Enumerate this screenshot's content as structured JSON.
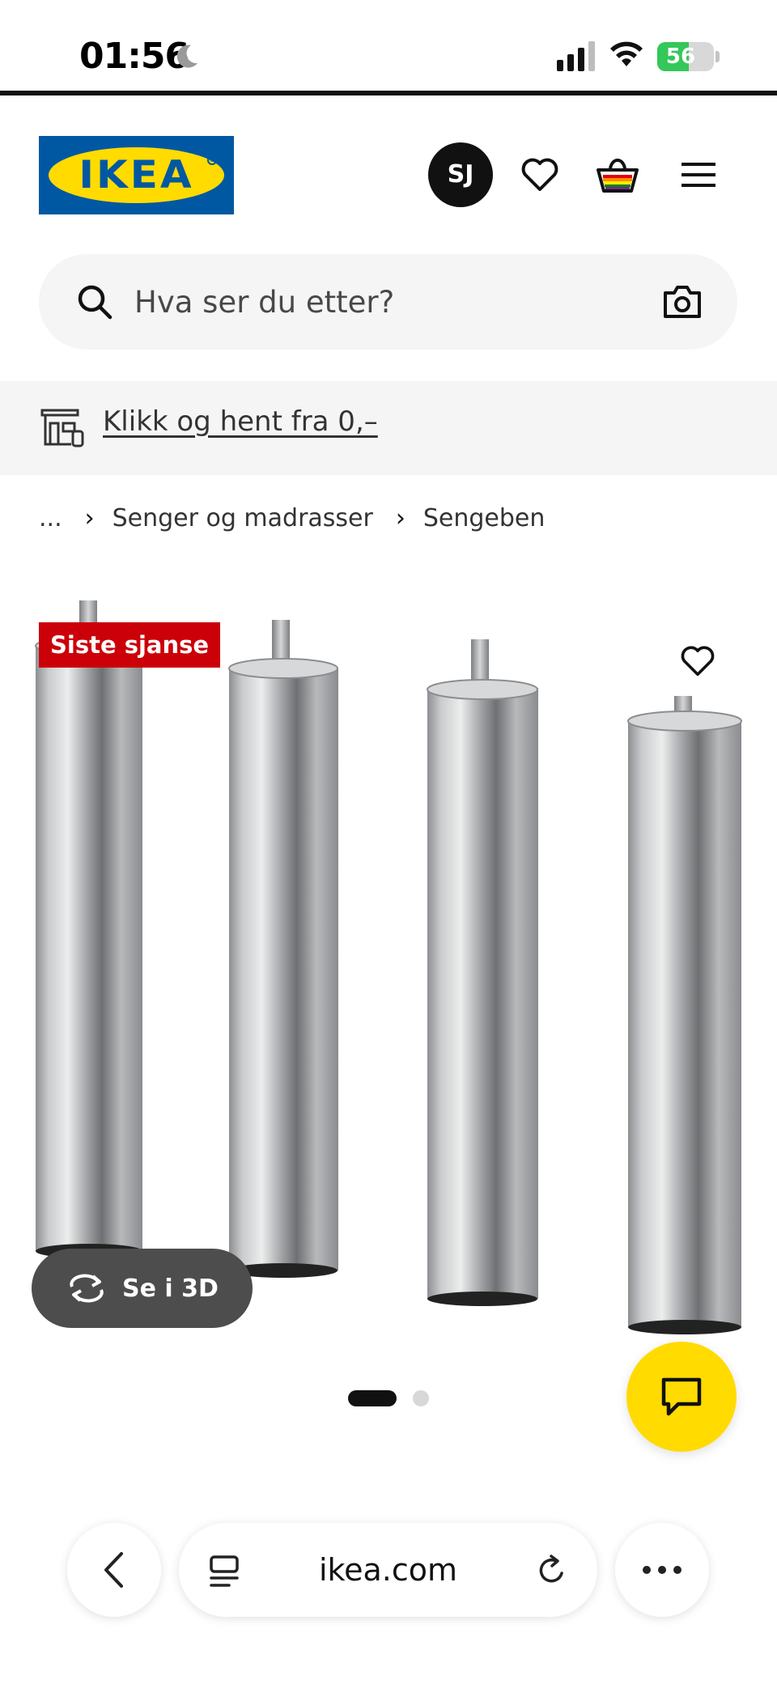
{
  "status_bar": {
    "time": "01:56",
    "battery_level": "56",
    "battery_fraction": 0.56
  },
  "header": {
    "logo_text": "IKEA",
    "avatar_initials": "SJ",
    "icons": [
      "heart-icon",
      "basket-icon",
      "menu-icon"
    ]
  },
  "search": {
    "placeholder": "Hva ser du etter?"
  },
  "promo": {
    "link_text": "Klikk og hent fra 0,–"
  },
  "breadcrumb": {
    "ellipsis": "...",
    "items": [
      "Senger og madrasser",
      "Sengeben"
    ]
  },
  "product": {
    "badge": "Siste sjanse",
    "view_3d_label": "Se i 3D",
    "image_count": 2,
    "active_image": 1
  },
  "browser": {
    "domain": "ikea.com"
  },
  "colors": {
    "ikea_blue": "#0058a3",
    "ikea_yellow": "#ffdb00",
    "badge_red": "#cc0008",
    "battery_green": "#34c759"
  }
}
